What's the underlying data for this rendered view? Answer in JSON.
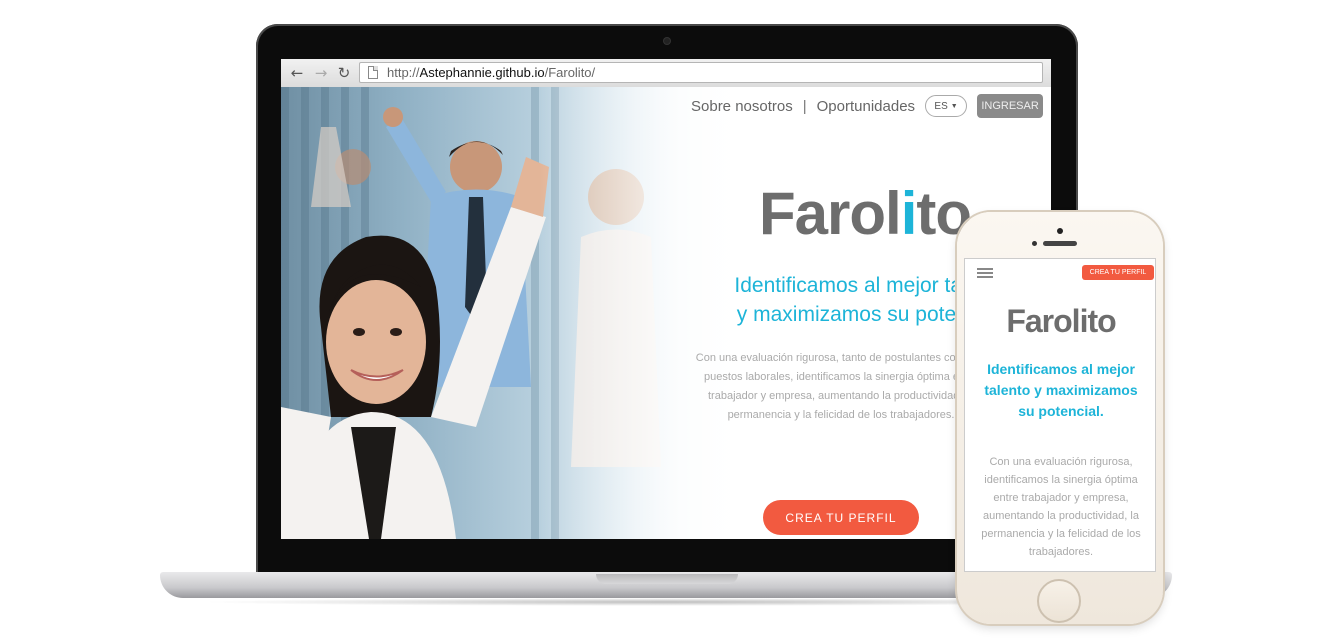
{
  "browser": {
    "url_prefix": "http://",
    "url_host": "Astephannie.github.io",
    "url_path": "/Farolito/",
    "back_icon": "arrow-left-icon",
    "forward_icon": "arrow-right-icon",
    "reload_icon": "reload-icon"
  },
  "nav": {
    "about": "Sobre nosotros",
    "separator": "|",
    "opportunities": "Oportunidades",
    "lang": "ES",
    "login": "INGRESAR"
  },
  "brand": {
    "logo_prefix": "Farol",
    "logo_i": "i",
    "logo_suffix": "to",
    "accent": "#1db4d8",
    "cta_color": "#f25a40"
  },
  "hero": {
    "headline_line1": "Identificamos al mejor talento",
    "headline_line2": "y maximizamos su potencial.",
    "body": "Con una evaluación rigurosa, tanto de postulantes como de puestos laborales, identificamos la sinergia óptima entre trabajador y empresa, aumentando la productividad, la permanencia y la felicidad de los trabajadores.",
    "cta": "CREA TU PERFIL"
  },
  "mobile": {
    "cta_top": "CREA TU PERFIL",
    "logo": "Farolito",
    "headline": "Identificamos al mejor talento y maximizamos su potencial.",
    "body": "Con una evaluación rigurosa, identificamos la sinergia óptima entre trabajador y empresa, aumentando la productividad, la permanencia y la felicidad de los trabajadores."
  }
}
